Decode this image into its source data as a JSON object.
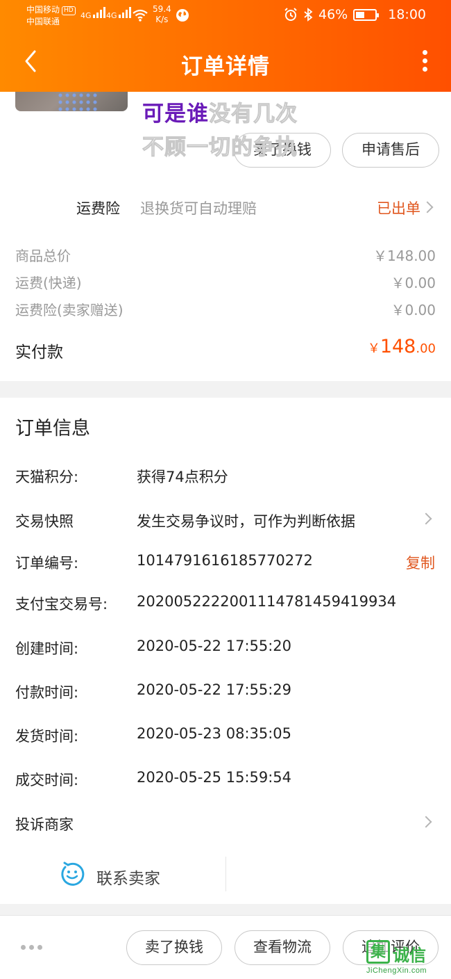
{
  "status_bar": {
    "carrier_1": "中国移动",
    "hd_badge": "HD",
    "carrier_2": "中国联通",
    "signal_1": "4G",
    "signal_2": "4G",
    "speed_value": "59.4",
    "speed_unit": "K/s",
    "battery": "46%",
    "time": "18:00"
  },
  "header": {
    "title": "订单详情"
  },
  "lyrics": {
    "line1_highlight": "可是谁",
    "line1_rest": "没有几次",
    "line2": "不顾一切的争执"
  },
  "product_actions": {
    "sell_label": "卖了换钱",
    "after_sale_label": "申请售后"
  },
  "insurance": {
    "label": "运费险",
    "description": "退换货可自动理赔",
    "status": "已出单"
  },
  "fees": [
    {
      "label": "商品总价",
      "value": "￥148.00"
    },
    {
      "label": "运费(快递)",
      "value": "￥0.00"
    },
    {
      "label": "运费险(卖家赠送)",
      "value": "￥0.00"
    }
  ],
  "total": {
    "label": "实付款",
    "currency": "￥",
    "integer": "148",
    "decimal": ".00"
  },
  "order_info": {
    "title": "订单信息",
    "points": {
      "label": "天猫积分:",
      "value": "获得74点积分"
    },
    "snapshot": {
      "label": "交易快照",
      "value": "发生交易争议时，可作为判断依据"
    },
    "order_no": {
      "label": "订单编号:",
      "value": "1014791616185770272",
      "action": "复制"
    },
    "alipay_no": {
      "label": "支付宝交易号:",
      "value": "2020052222001114781459419934"
    },
    "created": {
      "label": "创建时间:",
      "value": "2020-05-22 17:55:20"
    },
    "paid": {
      "label": "付款时间:",
      "value": "2020-05-22 17:55:29"
    },
    "shipped": {
      "label": "发货时间:",
      "value": "2020-05-23 08:35:05"
    },
    "closed": {
      "label": "成交时间:",
      "value": "2020-05-25 15:59:54"
    },
    "complain": {
      "label": "投诉商家"
    },
    "contact_label": "联系卖家"
  },
  "bottom_bar": {
    "sell_label": "卖了换钱",
    "logistics_label": "查看物流",
    "review_label": "追加评价"
  },
  "watermark": {
    "glyph": "集",
    "text": "诚信",
    "url": "JiChengXin.com"
  },
  "colors": {
    "header_start": "#ff8a00",
    "header_end": "#ff5000",
    "accent": "#ff5000",
    "action_text": "#e0571f",
    "lyric_highlight": "#6a1bb8",
    "contact_icon": "#2aa7e0"
  },
  "icons": [
    "back-arrow-icon",
    "more-vertical-icon",
    "chevron-right-icon",
    "contact-face-icon",
    "more-horizontal-icon",
    "battery-icon",
    "wifi-icon",
    "alarm-icon",
    "bluetooth-icon",
    "globe-icon"
  ]
}
